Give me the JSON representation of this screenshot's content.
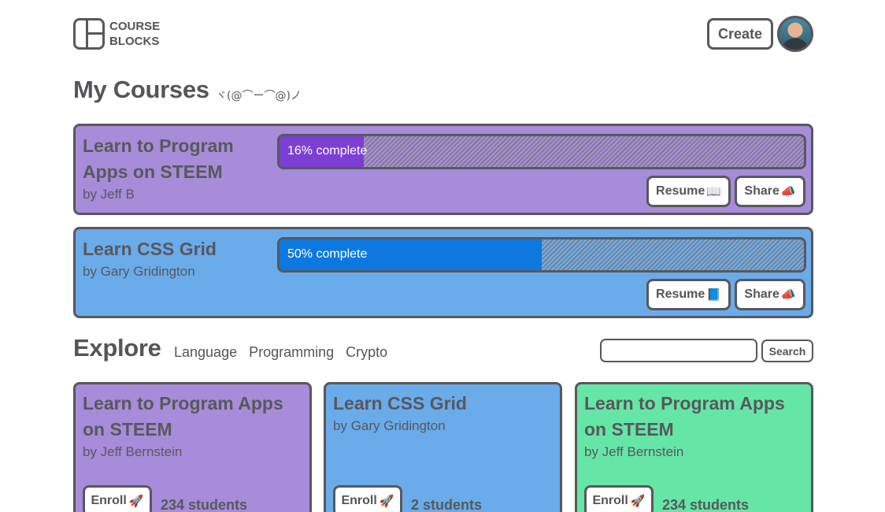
{
  "header": {
    "logo_line1": "COURSE",
    "logo_line2": "BLOCKS",
    "create_label": "Create"
  },
  "my_courses": {
    "title": "My Courses",
    "kaomoji": "ヾ(@⌒ー⌒@)ノ",
    "courses": [
      {
        "title": "Learn to Program Apps on STEEM",
        "author": "by Jeff B",
        "progress": 0.16,
        "progress_label": "16% complete",
        "resume_label": "Resume",
        "resume_icon": "📖",
        "share_label": "Share",
        "share_icon": "📣",
        "color": "#a68cd9",
        "fill_color": "#7b3fd4"
      },
      {
        "title": "Learn CSS Grid",
        "author": "by Gary Gridington",
        "progress": 0.5,
        "progress_label": "50% complete",
        "resume_label": "Resume",
        "resume_icon": "📘",
        "share_label": "Share",
        "share_icon": "📣",
        "color": "#6aabea",
        "fill_color": "#0d79e0"
      }
    ]
  },
  "explore": {
    "title": "Explore",
    "nav": [
      "Language",
      "Programming",
      "Crypto"
    ],
    "search_placeholder": "",
    "search_label": "Search",
    "courses": [
      {
        "title": "Learn to Program Apps on STEEM",
        "author": "by Jeff Bernstein",
        "enroll_label": "Enroll",
        "enroll_icon": "🚀",
        "students": "234 students",
        "color": "#a68cd9"
      },
      {
        "title": "Learn CSS Grid",
        "author": "by Gary Gridington",
        "enroll_label": "Enroll",
        "enroll_icon": "🚀",
        "students": "2 students",
        "color": "#6aabea"
      },
      {
        "title": "Learn to Program Apps on STEEM",
        "author": "by Jeff Bernstein",
        "enroll_label": "Enroll",
        "enroll_icon": "🚀",
        "students": "234 students",
        "color": "#66e6a6"
      }
    ]
  }
}
